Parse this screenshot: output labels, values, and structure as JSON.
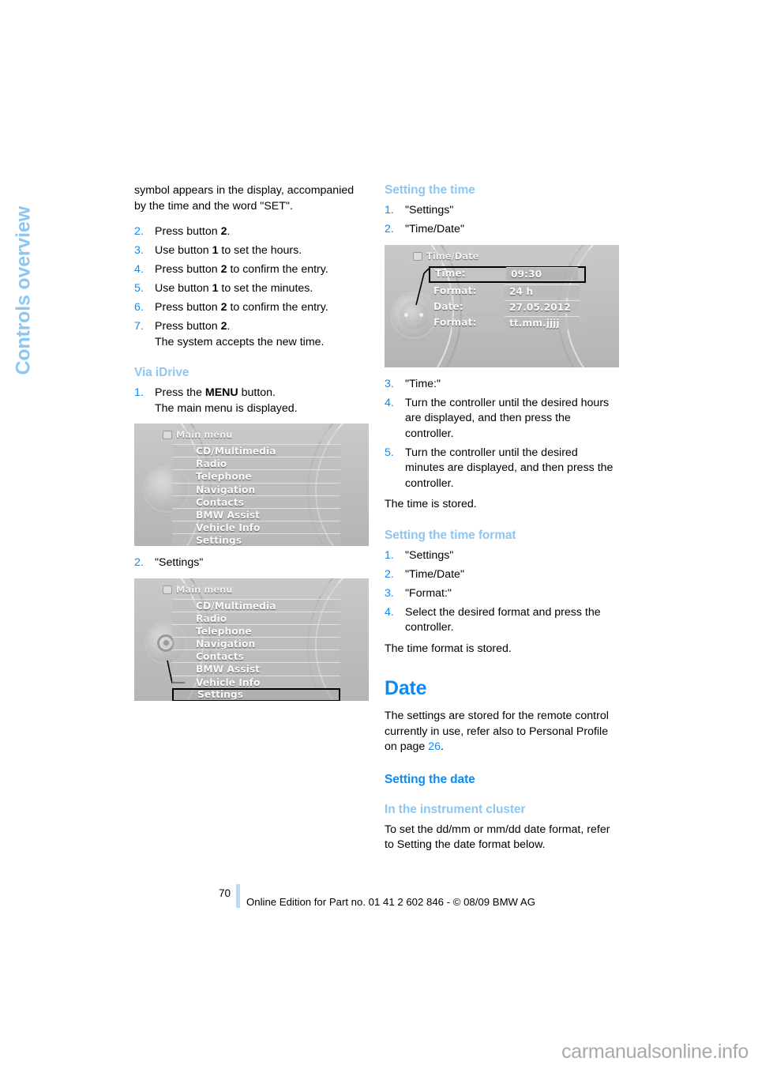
{
  "chapter_tab": {
    "label": "Controls overview",
    "color": "#8dc6f0"
  },
  "left_column": {
    "intro_paragraph": "symbol appears in the display, accompanied by the time and the word \"SET\".",
    "steps_continued": [
      {
        "num": "2.",
        "text_before": "Press button ",
        "bold": "2",
        "text_after": "."
      },
      {
        "num": "3.",
        "text_before": "Use button ",
        "bold": "1",
        "text_after": " to set the hours."
      },
      {
        "num": "4.",
        "text_before": "Press button ",
        "bold": "2",
        "text_after": " to confirm the entry."
      },
      {
        "num": "5.",
        "text_before": "Use button ",
        "bold": "1",
        "text_after": " to set the minutes."
      },
      {
        "num": "6.",
        "text_before": "Press button ",
        "bold": "2",
        "text_after": " to confirm the entry."
      },
      {
        "num": "7.",
        "text_before": "Press button ",
        "bold": "2",
        "text_after": ".",
        "sub": "The system accepts the new time."
      }
    ],
    "via_idrive_heading": "Via iDrive",
    "idrive_step1": {
      "num": "1.",
      "text_before": "Press the ",
      "bold": "MENU",
      "text_after": " button.",
      "sub": "The main menu is displayed."
    },
    "idrive_step2": {
      "num": "2.",
      "text": "\"Settings\""
    }
  },
  "figures": {
    "main_menu_1": {
      "title": "Main menu",
      "title_icon": "screen-icon",
      "items": [
        "CD/Multimedia",
        "Radio",
        "Telephone",
        "Navigation",
        "Contacts",
        "BMW Assist",
        "Vehicle Info",
        "Settings"
      ],
      "highlighted": null,
      "knob_icon": "controller-knob"
    },
    "main_menu_2": {
      "title": "Main menu",
      "title_icon": "screen-icon",
      "items": [
        "CD/Multimedia",
        "Radio",
        "Telephone",
        "Navigation",
        "Contacts",
        "BMW Assist",
        "Vehicle Info",
        "Settings"
      ],
      "highlighted": "Settings",
      "knob_icon": "gear-knob"
    },
    "time_date": {
      "title": "Time/Date",
      "title_icon": "clock-icon",
      "rows": [
        {
          "label": "Time:",
          "value": "09:30",
          "selected": true
        },
        {
          "label": "Format:",
          "value": "24 h",
          "selected": false
        },
        {
          "label": "Date:",
          "value": "27.05.2012",
          "selected": false
        },
        {
          "label": "Format:",
          "value": "tt.mm.jjjj",
          "selected": false
        }
      ],
      "knob_icon": "controller-knob"
    }
  },
  "right_column": {
    "setting_the_time": {
      "heading": "Setting the time",
      "steps": [
        {
          "num": "1.",
          "text": "\"Settings\""
        },
        {
          "num": "2.",
          "text": "\"Time/Date\""
        }
      ],
      "steps_after_figure": [
        {
          "num": "3.",
          "text": "\"Time:\""
        },
        {
          "num": "4.",
          "text": "Turn the controller until the desired hours are displayed, and then press the controller."
        },
        {
          "num": "5.",
          "text": "Turn the controller until the desired minutes are displayed, and then press the controller."
        }
      ],
      "closing": "The time is stored."
    },
    "setting_the_time_format": {
      "heading": "Setting the time format",
      "steps": [
        {
          "num": "1.",
          "text": "\"Settings\""
        },
        {
          "num": "2.",
          "text": "\"Time/Date\""
        },
        {
          "num": "3.",
          "text": "\"Format:\""
        },
        {
          "num": "4.",
          "text": "Select the desired format and press the controller."
        }
      ],
      "closing": "The time format is stored."
    },
    "date_section": {
      "heading": "Date",
      "paragraph_before_link": "The settings are stored for the remote control currently in use, refer also to Personal Profile on page ",
      "page_link": "26",
      "paragraph_after_link": ".",
      "setting_the_date_heading": "Setting the date",
      "instrument_cluster_heading": "In the instrument cluster",
      "instrument_cluster_text": "To set the dd/mm or mm/dd date format, refer to Setting the date format below."
    }
  },
  "footer": {
    "page_number": "70",
    "edition_text": "Online Edition for Part no. 01 41 2 602 846 - © 08/09 BMW AG"
  },
  "watermark": "carmanualsonline.info"
}
